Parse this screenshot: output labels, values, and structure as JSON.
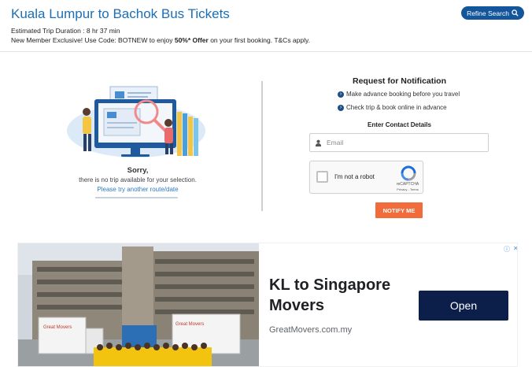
{
  "header": {
    "title": "Kuala Lumpur to Bachok Bus Tickets",
    "refine_label": "Refine Search",
    "duration": "Estimated Trip Duration : 8 hr 37 min",
    "promo_prefix": "New Member Exclusive! Use Code: BOTNEW to enjoy ",
    "promo_bold": "50%* Offer",
    "promo_suffix": " on your first booking. T&Cs apply."
  },
  "no_trip": {
    "title": "Sorry,",
    "message": "there is no trip available for your selection.",
    "link": "Please try another route/date"
  },
  "notification": {
    "title": "Request for Notification",
    "bullets": [
      "Make advance booking before you travel",
      "Check trip & book online in advance"
    ],
    "contact_title": "Enter Contact Details",
    "email_placeholder": "Email",
    "captcha_label": "I'm not a robot",
    "captcha_brand": "reCAPTCHA",
    "captcha_terms": "Privacy - Terms",
    "notify_label": "NOTIFY ME"
  },
  "ad": {
    "headline": "KL to Singapore Movers",
    "domain": "GreatMovers.com.my",
    "cta": "Open",
    "truck_brand": "Great Movers"
  },
  "colors": {
    "title_blue": "#1c6fb5",
    "refine_bg": "#14569c",
    "notify_orange": "#f26b3a",
    "ad_button": "#0b1f4a"
  },
  "icons": {
    "refine": "search-icon",
    "email": "user-icon",
    "bullet": "arrow-circle-icon",
    "ad": "adchoices-icon"
  }
}
